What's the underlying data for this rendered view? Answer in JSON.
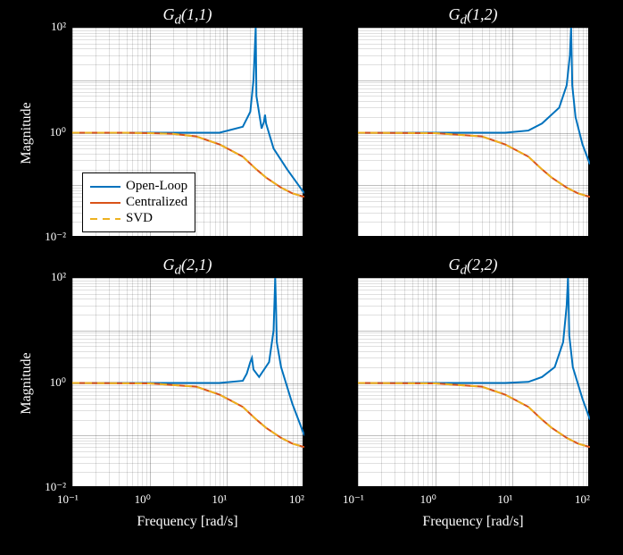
{
  "legend": {
    "open_loop": "Open-Loop",
    "centralized": "Centralized",
    "svd": "SVD"
  },
  "colors": {
    "open_loop": "#0072BD",
    "centralized": "#D95319",
    "svd": "#EDB120"
  },
  "axes": {
    "xlabel": "Frequency [rad/s]",
    "ylabel": "Magnitude",
    "x_ticks": [
      "10⁻¹",
      "10⁰",
      "10¹",
      "10²"
    ],
    "y_ticks": [
      "10⁻²",
      "10⁰",
      "10²"
    ],
    "xlim": [
      -1,
      2
    ],
    "ylim": [
      -2,
      2
    ],
    "xscale": "log",
    "yscale": "log"
  },
  "panels": [
    {
      "title_html": "G<sub>d</sub>(1,1)"
    },
    {
      "title_html": "G<sub>d</sub>(1,2)"
    },
    {
      "title_html": "G<sub>d</sub>(2,1)"
    },
    {
      "title_html": "G<sub>d</sub>(2,2)"
    }
  ],
  "chart_data": [
    {
      "type": "line",
      "title": "G_d(1,1)",
      "xlabel": "Frequency [rad/s]",
      "ylabel": "Magnitude",
      "xscale": "log",
      "yscale": "log",
      "xlim": [
        0.1,
        100
      ],
      "ylim": [
        0.01,
        100
      ],
      "series": [
        {
          "name": "Open-Loop",
          "x": [
            0.1,
            0.5,
            1,
            2,
            4,
            8,
            16,
            20,
            22,
            23.5,
            24,
            28,
            30,
            31,
            32,
            40,
            60,
            100
          ],
          "y": [
            1,
            1,
            1,
            1,
            1,
            1,
            1.3,
            2.5,
            10,
            100,
            5,
            1.2,
            1.6,
            2.2,
            1.5,
            0.5,
            0.2,
            0.07
          ]
        },
        {
          "name": "Centralized",
          "x": [
            0.1,
            0.5,
            1,
            2,
            4,
            8,
            16,
            24,
            32,
            50,
            70,
            100
          ],
          "y": [
            1,
            1,
            0.98,
            0.95,
            0.85,
            0.6,
            0.35,
            0.2,
            0.14,
            0.09,
            0.07,
            0.06
          ]
        },
        {
          "name": "SVD",
          "x": [
            0.1,
            0.5,
            1,
            2,
            4,
            8,
            16,
            24,
            32,
            50,
            70,
            100
          ],
          "y": [
            1,
            1,
            0.98,
            0.95,
            0.85,
            0.6,
            0.35,
            0.2,
            0.14,
            0.09,
            0.07,
            0.06
          ]
        }
      ]
    },
    {
      "type": "line",
      "title": "G_d(1,2)",
      "xlabel": "Frequency [rad/s]",
      "ylabel": "Magnitude",
      "xscale": "log",
      "yscale": "log",
      "xlim": [
        0.1,
        100
      ],
      "ylim": [
        0.01,
        100
      ],
      "series": [
        {
          "name": "Open-Loop",
          "x": [
            0.1,
            1,
            4,
            8,
            16,
            24,
            40,
            50,
            55,
            57,
            58,
            59,
            65,
            80,
            100
          ],
          "y": [
            1,
            1,
            1,
            1,
            1.1,
            1.5,
            3,
            8,
            30,
            100,
            30,
            8,
            2,
            0.6,
            0.25
          ]
        },
        {
          "name": "Centralized",
          "x": [
            0.1,
            1,
            4,
            8,
            16,
            24,
            32,
            50,
            70,
            100
          ],
          "y": [
            1,
            0.98,
            0.85,
            0.6,
            0.35,
            0.2,
            0.14,
            0.09,
            0.07,
            0.06
          ]
        },
        {
          "name": "SVD",
          "x": [
            0.1,
            1,
            4,
            8,
            16,
            24,
            32,
            50,
            70,
            100
          ],
          "y": [
            1,
            0.98,
            0.85,
            0.6,
            0.35,
            0.2,
            0.14,
            0.09,
            0.07,
            0.06
          ]
        }
      ]
    },
    {
      "type": "line",
      "title": "G_d(2,1)",
      "xlabel": "Frequency [rad/s]",
      "ylabel": "Magnitude",
      "xscale": "log",
      "yscale": "log",
      "xlim": [
        0.1,
        100
      ],
      "ylim": [
        0.01,
        100
      ],
      "series": [
        {
          "name": "Open-Loop",
          "x": [
            0.1,
            1,
            4,
            8,
            16,
            18,
            20,
            21,
            22,
            26,
            35,
            40,
            42,
            43,
            44,
            50,
            70,
            100
          ],
          "y": [
            1,
            1,
            1,
            1,
            1.1,
            1.5,
            2.5,
            3,
            1.8,
            1.3,
            2.5,
            10,
            100,
            30,
            6,
            2,
            0.4,
            0.1
          ]
        },
        {
          "name": "Centralized",
          "x": [
            0.1,
            1,
            4,
            8,
            16,
            24,
            32,
            50,
            70,
            100
          ],
          "y": [
            1,
            0.98,
            0.85,
            0.6,
            0.35,
            0.2,
            0.14,
            0.09,
            0.07,
            0.06
          ]
        },
        {
          "name": "SVD",
          "x": [
            0.1,
            1,
            4,
            8,
            16,
            24,
            32,
            50,
            70,
            100
          ],
          "y": [
            1,
            0.98,
            0.85,
            0.6,
            0.35,
            0.2,
            0.14,
            0.09,
            0.07,
            0.06
          ]
        }
      ]
    },
    {
      "type": "line",
      "title": "G_d(2,2)",
      "xlabel": "Frequency [rad/s]",
      "ylabel": "Magnitude",
      "xscale": "log",
      "yscale": "log",
      "xlim": [
        0.1,
        100
      ],
      "ylim": [
        0.01,
        100
      ],
      "series": [
        {
          "name": "Open-Loop",
          "x": [
            0.1,
            1,
            4,
            8,
            16,
            24,
            35,
            45,
            50,
            52,
            53,
            54,
            60,
            80,
            100
          ],
          "y": [
            1,
            1,
            1,
            1,
            1.05,
            1.3,
            2,
            6,
            30,
            100,
            30,
            8,
            2,
            0.5,
            0.2
          ]
        },
        {
          "name": "Centralized",
          "x": [
            0.1,
            1,
            4,
            8,
            16,
            24,
            32,
            50,
            70,
            100
          ],
          "y": [
            1,
            0.98,
            0.85,
            0.6,
            0.35,
            0.2,
            0.14,
            0.09,
            0.07,
            0.06
          ]
        },
        {
          "name": "SVD",
          "x": [
            0.1,
            1,
            4,
            8,
            16,
            24,
            32,
            50,
            70,
            100
          ],
          "y": [
            1,
            0.98,
            0.85,
            0.6,
            0.35,
            0.2,
            0.14,
            0.09,
            0.07,
            0.06
          ]
        }
      ]
    }
  ]
}
